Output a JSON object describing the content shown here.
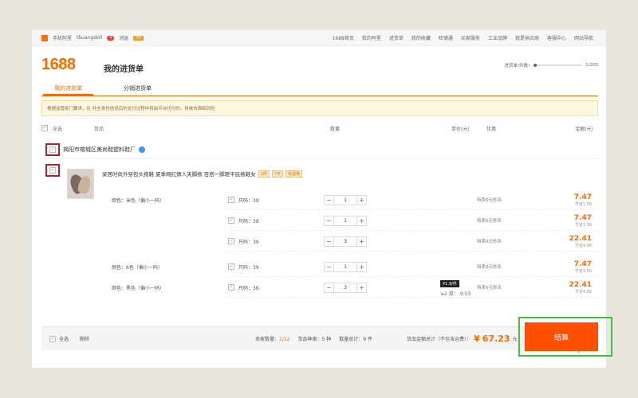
{
  "topbar": {
    "mobile_label": "手机阿里",
    "user_name": "tbuangdoll",
    "user_badge": "4",
    "msg_label": "消息",
    "msg_count": "70",
    "nav": [
      "1688首页",
      "我的阿里",
      "进货单",
      "我的收藏",
      "旺铺通",
      "买家服务",
      "工业品牌",
      "我是供应商",
      "客服中心",
      "网站导航"
    ]
  },
  "header": {
    "brand": "1688",
    "title": "我的进货单",
    "progress_label": "进货单(件数)",
    "progress_value": "1/200"
  },
  "tabs": [
    "我的进货单",
    "分销进货单"
  ],
  "notice": "根据监管部门要求，在 补全身份信息后的支付过程中将由平台代付的，将被市面临风险",
  "table_header": {
    "select_all": "全选",
    "product": "货品",
    "quantity": "数量",
    "unit_price": "单价(元)",
    "promo": "优惠",
    "amount": "金额(元)"
  },
  "seller": {
    "name": "揭阳市榕城区美尚鞋塑料鞋厂"
  },
  "product": {
    "title": "家居时尚外穿包头拖鞋 夏季网红情人夹脚拖 百搭一脚蹬平底拖鞋女",
    "tags": [
      "1件",
      "7天",
      "包退换"
    ],
    "price_badge": "¥1.9/件",
    "tier_label": "≥2 双：",
    "tier_price": "9.03",
    "variants": [
      {
        "color": "颜色：米色（偏小一码）",
        "size": "尺码：39",
        "qty": "1",
        "promo": "特卖0元秒杀",
        "amount": "7.47",
        "save": "节省1.56",
        "show_color": true
      },
      {
        "color": "",
        "size": "尺码：38",
        "qty": "1",
        "promo": "特卖0元秒杀",
        "amount": "7.47",
        "save": "节省1.56",
        "show_color": false
      },
      {
        "color": "",
        "size": "尺码：36",
        "qty": "3",
        "promo": "特卖0元秒杀",
        "amount": "22.41",
        "save": "节省4.68",
        "show_color": false
      },
      {
        "color": "颜色：6色（偏小一码）",
        "size": "尺码：39",
        "qty": "1",
        "promo": "特卖0元秒杀",
        "amount": "7.47",
        "save": "节省1.56",
        "show_color": true
      },
      {
        "color": "颜色：黑色（偏小一码）",
        "size": "尺码：36",
        "qty": "3",
        "promo": "特卖0元秒杀",
        "amount": "22.41",
        "save": "节省4.68",
        "show_color": true
      }
    ]
  },
  "footer": {
    "select_all": "全选",
    "delete": "删除",
    "seller_count_label": "卖家数量：",
    "seller_count": "1/12",
    "kinds_label": "货品种类：",
    "kinds": "5 种",
    "qty_label": "数量总计：",
    "qty": "9 件",
    "total_label": "货品金额总计（不包含运费）：",
    "currency": "¥",
    "total": "67.23",
    "unit": "元",
    "checkout": "结算"
  },
  "colors": {
    "accent": "#ff6a00",
    "checkout": "#ff5000",
    "highlight_green": "#3cc43c",
    "highlight_red": "#b21f2d"
  }
}
